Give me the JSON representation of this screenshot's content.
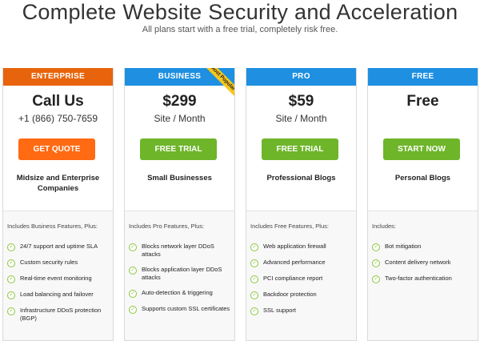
{
  "hero": {
    "title": "Complete Website Security and Acceleration",
    "subtitle": "All plans start with a free trial, completely risk free."
  },
  "colors": {
    "enterprise_header": "#e8640c",
    "blue_header": "#1e8fe1",
    "cta_orange": "#ff6a13",
    "cta_green": "#6eb52a",
    "check_green": "#8cc63f",
    "ribbon_yellow": "#f7c71d"
  },
  "plans": [
    {
      "name": "ENTERPRISE",
      "price": "Call Us",
      "unit": "+1 (866) 750-7659",
      "cta": "GET QUOTE",
      "target": "Midsize and Enterprise Companies",
      "features_intro": "Includes Business Features, Plus:",
      "features": [
        "24/7 support and uptime SLA",
        "Custom security rules",
        "Real-time event monitoring",
        "Load balancing and failover",
        "Infrastructure DDoS protection (BGP)"
      ]
    },
    {
      "name": "BUSINESS",
      "ribbon": "Most Popular",
      "price": "$299",
      "unit": "Site / Month",
      "cta": "FREE TRIAL",
      "target": "Small Businesses",
      "features_intro": "Includes Pro Features, Plus:",
      "features": [
        "Blocks network layer DDoS attacks",
        "Blocks application layer DDoS attacks",
        "Auto-detection & triggering",
        "Supports custom SSL certificates"
      ]
    },
    {
      "name": "PRO",
      "price": "$59",
      "unit": "Site / Month",
      "cta": "FREE TRIAL",
      "target": "Professional Blogs",
      "features_intro": "Includes Free Features, Plus:",
      "features": [
        "Web application firewall",
        "Advanced performance",
        "PCI compliance report",
        "Backdoor protection",
        "SSL support"
      ]
    },
    {
      "name": "FREE",
      "price": "Free",
      "unit": "",
      "cta": "START NOW",
      "target": "Personal Blogs",
      "features_intro": "Includes:",
      "features": [
        "Bot mitigation",
        "Content delivery network",
        "Two-factor authentication"
      ]
    }
  ]
}
